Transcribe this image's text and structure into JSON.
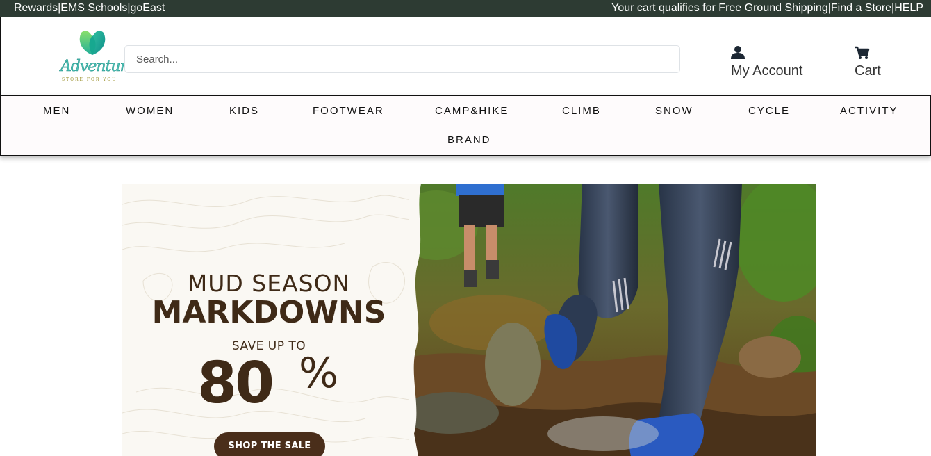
{
  "topbar": {
    "links_left": [
      "Rewards",
      "EMS Schools",
      "goEast"
    ],
    "shipping_text": "Your cart qualifies for Free Ground Shipping",
    "links_right": [
      "Find a Store",
      "HELP"
    ],
    "separator": "|"
  },
  "header": {
    "logo_text": "Adventure",
    "logo_tagline": "STORE FOR YOU",
    "search_placeholder": "Search...",
    "account_label": "My Account",
    "cart_label": "Cart"
  },
  "nav": {
    "items": [
      "MEN",
      "WOMEN",
      "KIDS",
      "FOOTWEAR",
      "CAMP&HIKE",
      "CLIMB",
      "SNOW",
      "CYCLE",
      "ACTIVITY",
      "BRAND"
    ]
  },
  "hero": {
    "line1": "MUD SEASON",
    "line2": "MARKDOWNS",
    "save_text": "SAVE UP TO",
    "discount_number": "80",
    "discount_symbol": "%",
    "cta_label": "SHOP THE SALE"
  },
  "colors": {
    "topbar_bg": "#2d3b33",
    "brand_teal": "#4fc1b6",
    "hero_brown": "#3f2a17",
    "cta_bg": "#4a2e1a"
  }
}
